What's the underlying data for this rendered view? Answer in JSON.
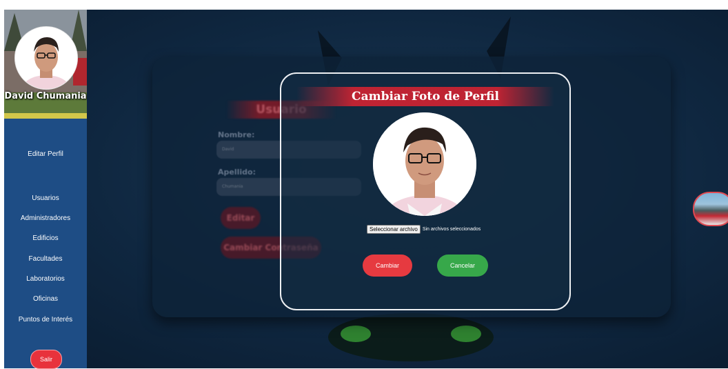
{
  "sidebar": {
    "profile_name": "David Chumania",
    "edit_profile": "Editar Perfil",
    "items": [
      {
        "label": "Usuarios"
      },
      {
        "label": "Administradores"
      },
      {
        "label": "Edificios"
      },
      {
        "label": "Facultades"
      },
      {
        "label": "Laboratorios"
      },
      {
        "label": "Oficinas"
      },
      {
        "label": "Puntos de Interés"
      }
    ],
    "logout": "Salir"
  },
  "background_form": {
    "title": "Usuario",
    "name_label": "Nombre:",
    "name_value": "David",
    "lastname_label": "Apellido:",
    "lastname_value": "Chumania",
    "edit_button": "Editar",
    "change_password_button": "Cambiar Contraseña"
  },
  "modal": {
    "title": "Cambiar Foto de Perfil",
    "file_button": "Seleccionar archivo",
    "file_status": "Sin archivos seleccionados",
    "change_button": "Cambiar",
    "cancel_button": "Cancelar"
  },
  "colors": {
    "sidebar": "#1e4d85",
    "accent_red": "#e63a40",
    "accent_green": "#37a84a",
    "background": "#0f2740"
  }
}
